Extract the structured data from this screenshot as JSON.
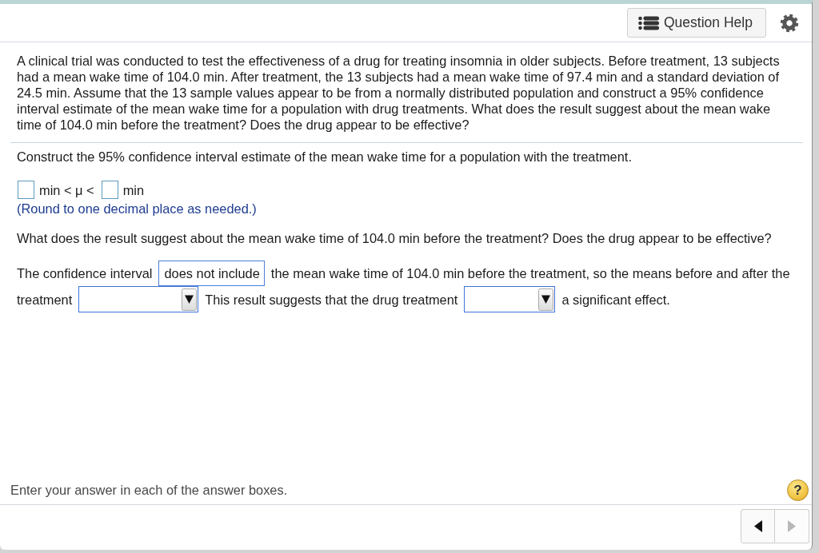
{
  "header": {
    "help_button": {
      "label": "Question Help"
    }
  },
  "question": {
    "text": "A clinical trial was conducted to test the effectiveness of a drug for treating insomnia in older subjects. Before treatment, 13 subjects had a mean wake time of 104.0 min. After treatment, the 13 subjects had a mean wake time of 97.4 min and a standard deviation of 24.5 min. Assume that the 13 sample values appear to be from a normally distributed population and construct a 95% confidence interval estimate of the mean wake time for a population with drug treatments. What does the result suggest about the mean wake time of 104.0 min before the treatment? Does the drug appear to be effective?"
  },
  "part_1": {
    "prompt": "Construct the 95% confidence interval estimate of the mean wake time for a population with the treatment.",
    "answer_row": [
      {
        "kind": "answer_box"
      },
      {
        "kind": "text",
        "text": "min < μ <"
      },
      {
        "kind": "answer_box"
      },
      {
        "kind": "text",
        "text": "min"
      }
    ],
    "hint": "(Round to one decimal place as needed.)"
  },
  "part_2": {
    "prompt": "What does the result suggest about the mean wake time of 104.0 min before the treatment? Does the drug appear to be effective?",
    "answer_lines": [
      [
        {
          "kind": "text",
          "text": "The confidence interval"
        },
        {
          "kind": "dropdown",
          "value": "does not include"
        },
        {
          "kind": "text",
          "text": "the mean wake time of 104.0 min before the treatment, so the means before and after the"
        }
      ],
      [
        {
          "kind": "text",
          "text": "treatment"
        },
        {
          "kind": "dropdown"
        },
        {
          "kind": "text",
          "text": "This result suggests that the drug treatment"
        },
        {
          "kind": "dropdown"
        },
        {
          "kind": "text",
          "text": "a significant effect."
        }
      ]
    ]
  },
  "footer": {
    "instruction": "Enter your answer in each of the answer boxes.",
    "help_button": {
      "label": "?"
    },
    "nav": [
      {
        "kind": "previous",
        "disabled": false
      },
      {
        "kind": "next",
        "disabled": true
      }
    ]
  }
}
